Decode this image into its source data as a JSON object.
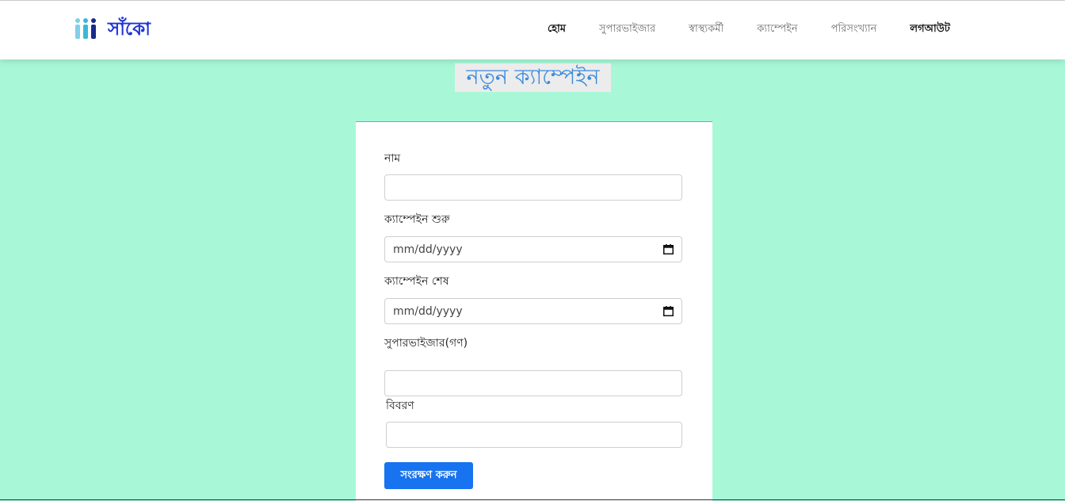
{
  "brand": {
    "name": "সাঁকো",
    "logo_icon": "people-group-icon",
    "accent_color": "#1f33d6"
  },
  "nav": {
    "items": [
      {
        "label": "হোম",
        "active": true
      },
      {
        "label": "সুপারভাইজার"
      },
      {
        "label": "স্বাস্থ্যকর্মী"
      },
      {
        "label": "ক্যাম্পেইন"
      },
      {
        "label": "পরিসংখ্যান"
      },
      {
        "label": "লগআউট"
      }
    ]
  },
  "page": {
    "title": "নতুন ক্যাম্পেইন",
    "background_color": "#a8f8d8"
  },
  "form": {
    "name_label": "নাম",
    "name_value": "",
    "start_label": "ক্যাম্পেইন শুরু",
    "start_placeholder": "mm/dd/yyyy",
    "end_label": "ক্যাম্পেইন শেষ",
    "end_placeholder": "mm/dd/yyyy",
    "supervisors_label": "সুপারভাইজার(গণ)",
    "supervisors_value": "",
    "description_label": "বিবরণ",
    "description_value": "",
    "save_label": "সংরক্ষণ করুন",
    "save_color": "#1773f0"
  }
}
